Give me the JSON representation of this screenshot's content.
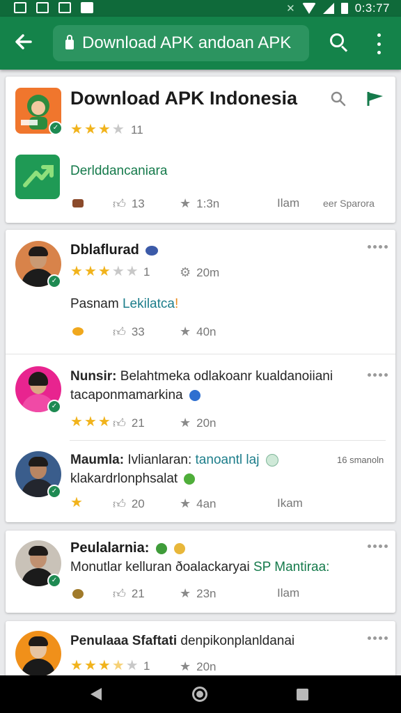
{
  "status_bar": {
    "time": "0:3:77"
  },
  "toolbar": {
    "url": "Download APK andoan APK"
  },
  "app_card": {
    "title": "Download APK Indonesia",
    "rating_text": "11",
    "developer": "Derlddancaniara",
    "likes": "13",
    "stars_count": "1:3n",
    "item_label": "Ilam",
    "meta": "eer Sparora",
    "accent": "#157a4b"
  },
  "reviews": [
    {
      "name": "Dblaflurad",
      "rating_text": "1",
      "stat": "20m",
      "body_prefix": "Pasnam",
      "body_link": "Lekilatca",
      "likes": "33",
      "stars_count": "40n",
      "rating": 3
    },
    {
      "name": "Nunsir:",
      "line1": "Belahtmeka odlakoanr kualdanoiiani",
      "line2": "tacaponmamarkina",
      "likes": "21",
      "stars_count": "20n",
      "rating": 3
    },
    {
      "name": "Maumla:",
      "line1_prefix": "Ivlianlaran:",
      "line1_link": "tanoantl laj",
      "side_meta": "16 smanoln",
      "line2": "klakardrlonphsalat",
      "likes": "20",
      "stars_count": "4an",
      "item_label": "Ikam",
      "rating": 1
    },
    {
      "name": "Peulalarnia:",
      "line1_prefix": "Monutlar kelluran ðoalackaryai",
      "line1_link": "SP Mantiraa:",
      "likes": "21",
      "stars_count": "23n",
      "item_label": "Ilam"
    },
    {
      "name": "Penulaaa Sfaftati",
      "line1": "denpikonplanldanai",
      "rating_text": "1",
      "stars_count": "20n",
      "rating": 3.5
    }
  ]
}
